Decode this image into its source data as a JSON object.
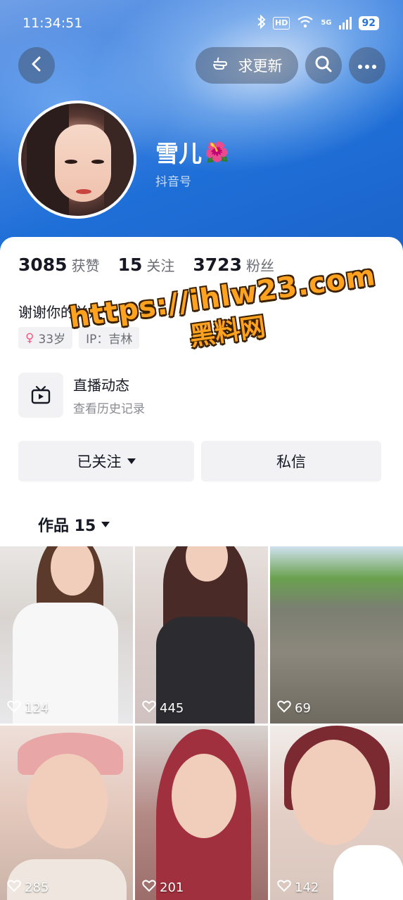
{
  "status_bar": {
    "time": "11:34:51",
    "hd": "HD",
    "network": "5G",
    "battery": "92"
  },
  "nav": {
    "update_label": "求更新"
  },
  "profile": {
    "name": "雪儿",
    "name_emoji": "🌺",
    "douyin_id_label": "抖音号"
  },
  "stats": [
    {
      "value": "3085",
      "label": "获赞"
    },
    {
      "value": "15",
      "label": "关注"
    },
    {
      "value": "3723",
      "label": "粉丝"
    }
  ],
  "bio": "谢谢你的关注",
  "tags": {
    "age": "33岁",
    "ip": "IP：吉林"
  },
  "live": {
    "title": "直播动态",
    "subtitle": "查看历史记录"
  },
  "actions": {
    "followed_label": "已关注",
    "message_label": "私信"
  },
  "works_tab": {
    "label": "作品 15"
  },
  "watermark": {
    "url": "https://ihlw23.com",
    "text": "黑料网"
  },
  "videos": [
    {
      "likes": "124"
    },
    {
      "likes": "445"
    },
    {
      "likes": "69"
    },
    {
      "likes": "285"
    },
    {
      "likes": "201"
    },
    {
      "likes": "142"
    }
  ],
  "colors": {
    "banner": "#1f6fd8",
    "button_bg": "#f2f2f4",
    "watermark": "#ffa21f",
    "gender_pink": "#f25a84"
  }
}
